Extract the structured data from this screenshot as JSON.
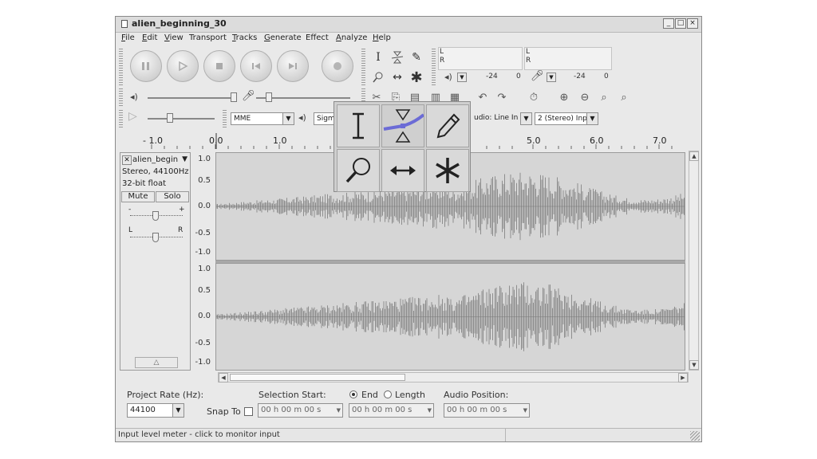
{
  "window": {
    "title": "alien_beginning_30",
    "controls": {
      "minimize": "_",
      "maximize": "□",
      "close": "×"
    }
  },
  "menu": {
    "items": [
      {
        "label": "File",
        "key": "F",
        "rest": "ile"
      },
      {
        "label": "Edit",
        "key": "E",
        "rest": "dit"
      },
      {
        "label": "View",
        "key": "V",
        "rest": "iew"
      },
      {
        "label": "Transport",
        "key": "",
        "rest": "Transport"
      },
      {
        "label": "Tracks",
        "key": "T",
        "rest": "racks"
      },
      {
        "label": "Generate",
        "key": "G",
        "rest": "enerate"
      },
      {
        "label": "Effect",
        "key": "",
        "rest": "Effect"
      },
      {
        "label": "Analyze",
        "key": "A",
        "rest": "nalyze"
      },
      {
        "label": "Help",
        "key": "H",
        "rest": "elp"
      }
    ]
  },
  "meters": {
    "play": {
      "L": "L",
      "R": "R",
      "scale": [
        "-24",
        "0"
      ]
    },
    "record": {
      "L": "L",
      "R": "R",
      "scale": [
        "-24",
        "0"
      ]
    }
  },
  "device": {
    "host": "MME",
    "output": "Sigma",
    "input": "udio: Line In",
    "channels": "2 (Stereo) Inp"
  },
  "ruler": {
    "ticks": [
      "- 1.0",
      "0.0",
      "1.0",
      "5.0",
      "6.0",
      "7.0"
    ]
  },
  "track": {
    "name": "alien_begin",
    "info1": "Stereo, 44100Hz",
    "info2": "32-bit float",
    "mute": "Mute",
    "solo": "Solo",
    "gain_minus": "-",
    "gain_plus": "+",
    "pan_left": "L",
    "pan_right": "R",
    "scale": [
      "1.0",
      "0.5",
      "0.0",
      "-0.5",
      "-1.0"
    ]
  },
  "bottom": {
    "project_rate_label": "Project Rate (Hz):",
    "project_rate_value": "44100",
    "snap_label": "Snap To",
    "selection_start_label": "Selection Start:",
    "end_label": "End",
    "length_label": "Length",
    "audio_position_label": "Audio Position:",
    "time1": "00 h 00 m 00 s",
    "time2": "00 h 00 m 00 s",
    "time3": "00 h 00 m 00 s"
  },
  "status": {
    "text": "Input level meter - click to monitor input"
  },
  "colors": {
    "waveform": "#8e8e8e",
    "envelope_blue": "#6b6bd6"
  }
}
